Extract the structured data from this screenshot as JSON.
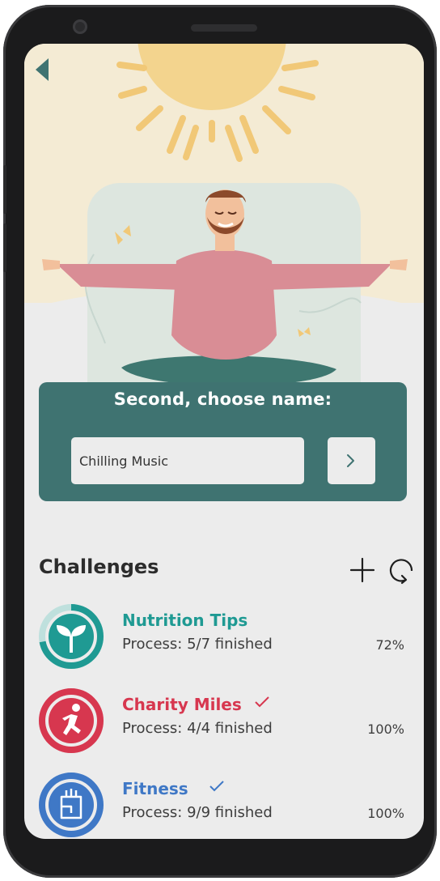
{
  "form": {
    "title": "Second, choose name:",
    "name_value": "Chilling Music",
    "submit_icon": "chevron-right-icon"
  },
  "challenges": {
    "title": "Challenges",
    "add_icon": "plus-icon",
    "refresh_icon": "refresh-icon",
    "items": [
      {
        "name": "Nutrition Tips",
        "process": "Process: 5/7 finished",
        "percent": "72%",
        "progress": 0.72,
        "completed": false,
        "color": "#1f9a93",
        "icon": "sprout-icon"
      },
      {
        "name": "Charity Miles",
        "process": "Process: 4/4 finished",
        "percent": "100%",
        "progress": 1.0,
        "completed": true,
        "color": "#d7374f",
        "icon": "running-person-icon"
      },
      {
        "name": "Fitness",
        "process": "Process: 9/9 finished",
        "percent": "100%",
        "progress": 1.0,
        "completed": true,
        "color": "#3f78c6",
        "icon": "fist-icon"
      }
    ]
  },
  "colors": {
    "card": "#3f7371",
    "background": "#ececec",
    "sky": "#f4ebd4",
    "sun": "#f1c877"
  }
}
